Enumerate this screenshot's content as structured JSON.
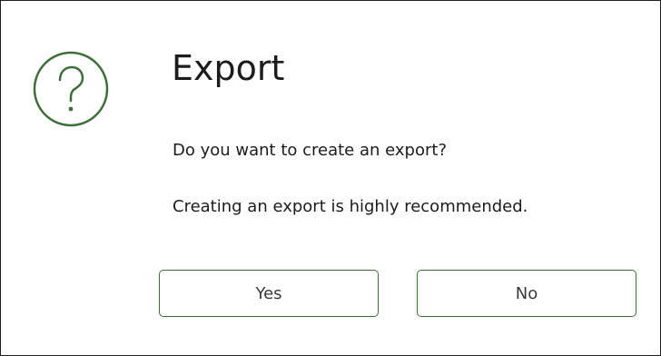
{
  "dialog": {
    "title": "Export",
    "icon": "question-circle-icon",
    "messages": [
      "Do you want to create an export?",
      "Creating an export is highly recommended."
    ],
    "buttons": {
      "yes_label": "Yes",
      "no_label": "No"
    },
    "colors": {
      "accent": "#3f6e3a",
      "text": "#1c1c1c",
      "border": "#1f1f1f"
    }
  }
}
